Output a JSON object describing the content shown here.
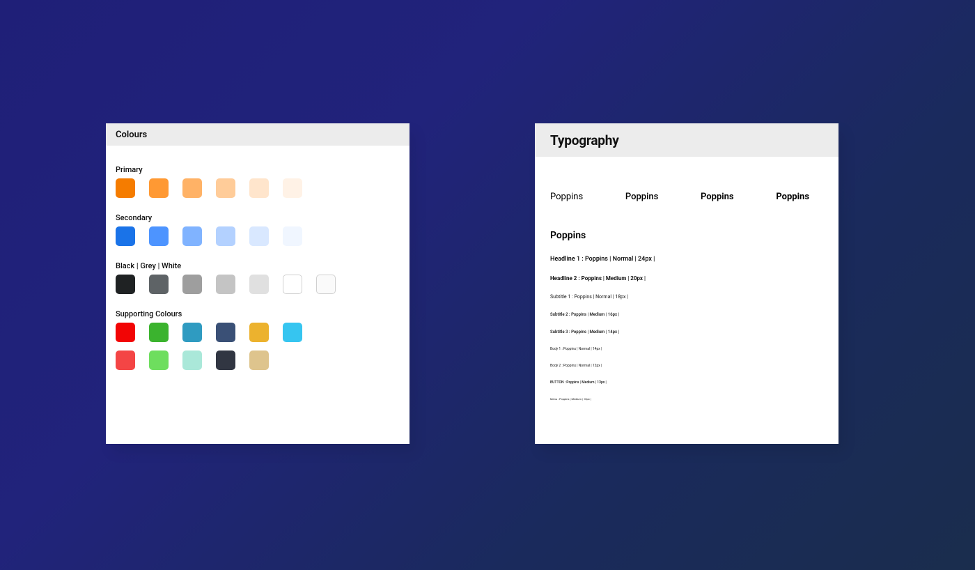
{
  "colours": {
    "title": "Colours",
    "groups": [
      {
        "label": "Primary",
        "rows": [
          [
            {
              "hex": "#f57c00"
            },
            {
              "hex": "#ff9933"
            },
            {
              "hex": "#ffb266"
            },
            {
              "hex": "#ffcc99"
            },
            {
              "hex": "#ffe5cc"
            },
            {
              "hex": "#fff2e6"
            }
          ]
        ]
      },
      {
        "label": "Secondary",
        "rows": [
          [
            {
              "hex": "#1a73e8"
            },
            {
              "hex": "#4d94ff"
            },
            {
              "hex": "#80b3ff"
            },
            {
              "hex": "#b3d1ff"
            },
            {
              "hex": "#d9e8ff"
            },
            {
              "hex": "#f0f6ff"
            }
          ]
        ]
      },
      {
        "label": "Black | Grey | White",
        "rows": [
          [
            {
              "hex": "#1f2223"
            },
            {
              "hex": "#5e6366"
            },
            {
              "hex": "#9e9e9e"
            },
            {
              "hex": "#c4c4c4"
            },
            {
              "hex": "#e0e0e0"
            },
            {
              "hex": "#ffffff",
              "bordered": true
            },
            {
              "hex": "#fafafa",
              "bordered": true
            }
          ]
        ]
      },
      {
        "label": "Supporting Colours",
        "rows": [
          [
            {
              "hex": "#f20505"
            },
            {
              "hex": "#3bb32e"
            },
            {
              "hex": "#2f9bc1"
            },
            {
              "hex": "#3a5076"
            },
            {
              "hex": "#ecb22e"
            },
            {
              "hex": "#36c5f0"
            }
          ],
          [
            {
              "hex": "#f44545"
            },
            {
              "hex": "#6ede5e"
            },
            {
              "hex": "#aae8d9"
            },
            {
              "hex": "#313642"
            },
            {
              "hex": "#dec48d"
            }
          ]
        ]
      }
    ]
  },
  "typography": {
    "title": "Typography",
    "font_family": "Poppins",
    "weights": [
      {
        "label": "Poppins",
        "css": "w-reg"
      },
      {
        "label": "Poppins",
        "css": "w-med"
      },
      {
        "label": "Poppins",
        "css": "w-sbold"
      },
      {
        "label": "Poppins",
        "css": "w-bold"
      }
    ],
    "specs": [
      {
        "text": "Headline 1 : Poppins | Normal | 24px |",
        "size": "s9",
        "weight": "w-sbold"
      },
      {
        "text": "Headline 2 : Poppins | Medium | 20px |",
        "size": "s8",
        "weight": "w-bold"
      },
      {
        "text": "Subtitle 1 : Poppins | Normal | 18px |",
        "size": "s7",
        "weight": "w-reg"
      },
      {
        "text": "Subtitle 2 : Poppins | Medium | 16px |",
        "size": "s6",
        "weight": "w-med"
      },
      {
        "text": "Subtitle 3 : Poppins | Medium | 14px |",
        "size": "s6",
        "weight": "w-med"
      },
      {
        "text": "Body 1 : Poppins | Normal | 14px |",
        "size": "s5",
        "weight": "w-reg"
      },
      {
        "text": "Body 2 : Poppins | Normal | 12px |",
        "size": "s5",
        "weight": "w-reg"
      },
      {
        "text": "BUTTON : Poppins | Medium | 13px |",
        "size": "s5",
        "weight": "w-med"
      },
      {
        "text": "Menu : Poppins | Medium | 10px |",
        "size": "s4",
        "weight": "w-reg"
      }
    ]
  }
}
